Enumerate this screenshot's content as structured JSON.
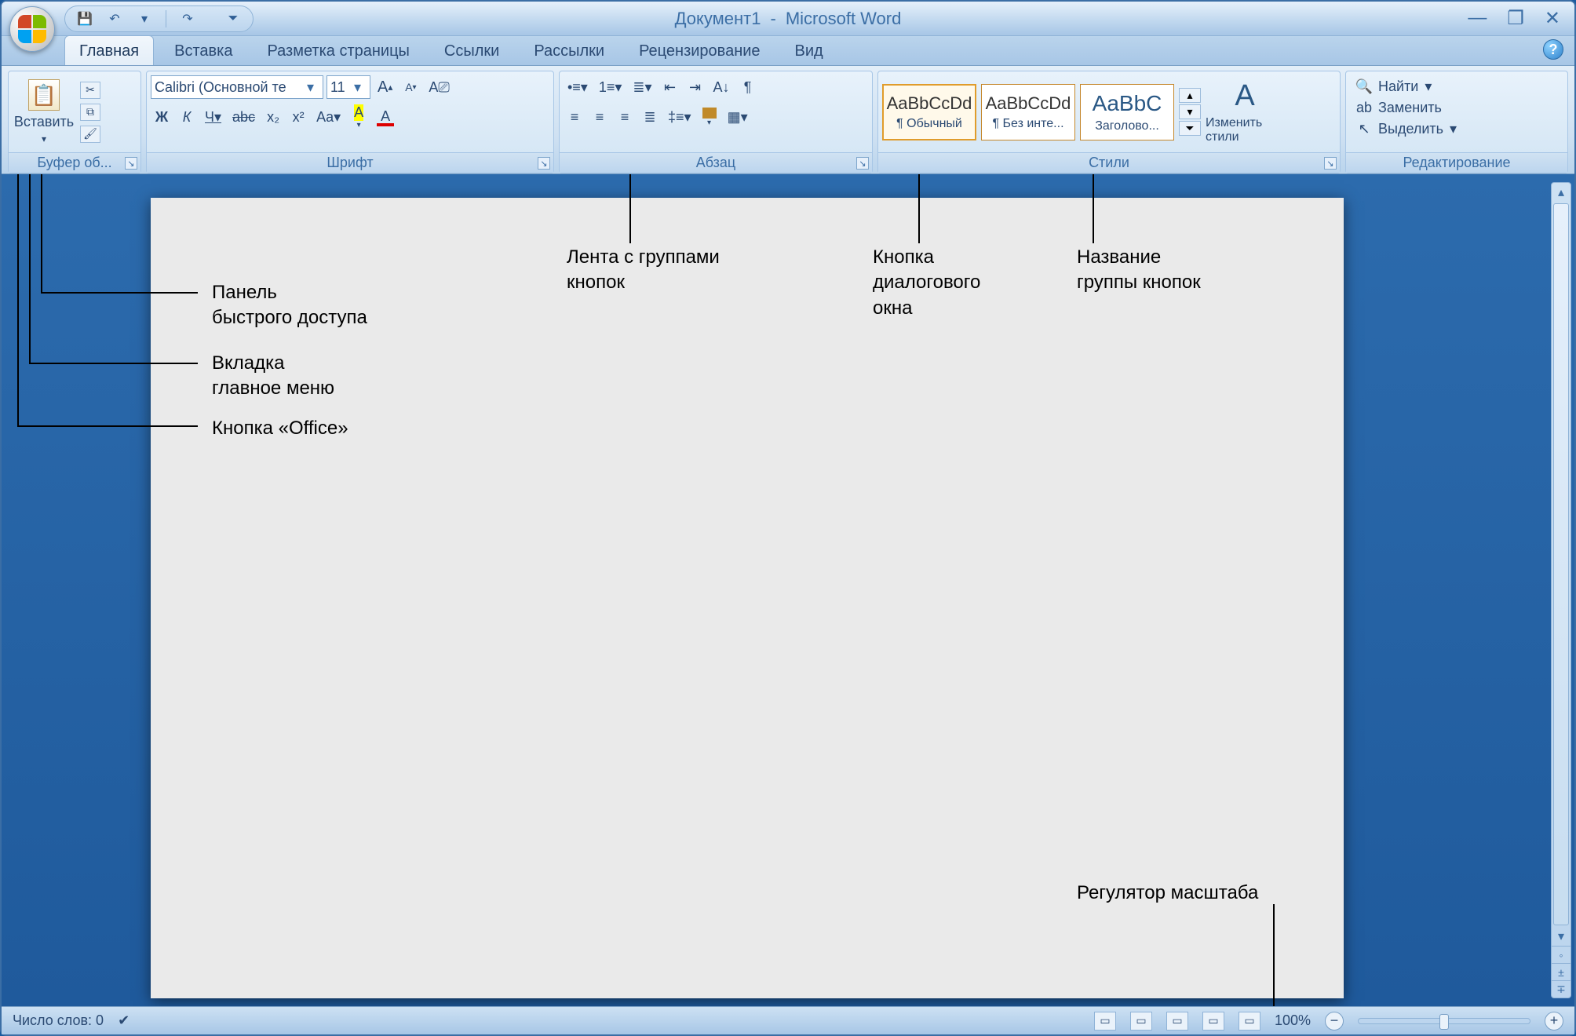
{
  "title": {
    "document": "Документ1",
    "app": "Microsoft Word"
  },
  "tabs": [
    "Главная",
    "Вставка",
    "Разметка страницы",
    "Ссылки",
    "Рассылки",
    "Рецензирование",
    "Вид"
  ],
  "clipboard": {
    "label": "Буфер об...",
    "paste": "Вставить"
  },
  "font": {
    "label": "Шрифт",
    "name": "Calibri (Основной те",
    "size": "11",
    "bold": "Ж",
    "italic": "К",
    "underline": "Ч",
    "strike": "abc",
    "sub": "x₂",
    "sup": "x²",
    "case": "Aa",
    "highlight": "A",
    "color": "A"
  },
  "paragraph": {
    "label": "Абзац"
  },
  "styles": {
    "label": "Стили",
    "items": [
      {
        "preview": "AaBbCcDd",
        "name": "¶ Обычный"
      },
      {
        "preview": "AaBbCcDd",
        "name": "¶ Без инте..."
      },
      {
        "preview": "AaBbC",
        "name": "Заголово..."
      }
    ],
    "change": "Изменить стили"
  },
  "editing": {
    "label": "Редактирование",
    "find": "Найти",
    "replace": "Заменить",
    "select": "Выделить"
  },
  "status": {
    "words": "Число слов: 0",
    "zoom": "100%"
  },
  "annotations": {
    "qat": "Панель\nбыстрого доступа",
    "tab": "Вкладка\nглавное меню",
    "office": "Кнопка «Office»",
    "ribbon": "Лента с группами\nкнопок",
    "dialog": "Кнопка\nдиалогового\nокна",
    "groupname": "Название\nгруппы кнопок",
    "zoom": "Регулятор масштаба"
  }
}
